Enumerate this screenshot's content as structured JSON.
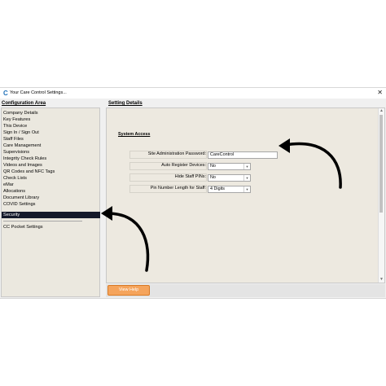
{
  "window": {
    "title": "Your Care Control Settings...",
    "icon": "care-control-logo-icon",
    "close_glyph": "✕"
  },
  "left_panel": {
    "header": "Configuration Area",
    "items": [
      "Company Details",
      "Key Features",
      "This Device",
      "Sign In / Sign Out",
      "Staff Files",
      "Care Management",
      "Supervisions",
      "Integrity Check Rules",
      "Videos and Images",
      "QR Codes and NFC Tags",
      "Check Lists",
      "eMar",
      "Allocations",
      "Document Library",
      "COVID Settings",
      "Security"
    ],
    "selected": "Security",
    "extra_items": [
      "CC Pocket Settings"
    ]
  },
  "right_panel": {
    "header": "Setting Details",
    "group_title": "System Access",
    "fields": [
      {
        "label": "Site Administration Password:",
        "value": "CareControl",
        "type": "text"
      },
      {
        "label": "Auto Register Devices:",
        "value": "No",
        "type": "select"
      },
      {
        "label": "Hide Staff PINs:",
        "value": "No",
        "type": "select"
      },
      {
        "label": "Pin Number Length for Staff:",
        "value": "4 Digits",
        "type": "select"
      }
    ]
  },
  "footer": {
    "help_button": "View Help"
  },
  "colors": {
    "selected_bg": "#14192a",
    "help_button": "#f5a45c",
    "panel_bg": "#ebe8df"
  }
}
